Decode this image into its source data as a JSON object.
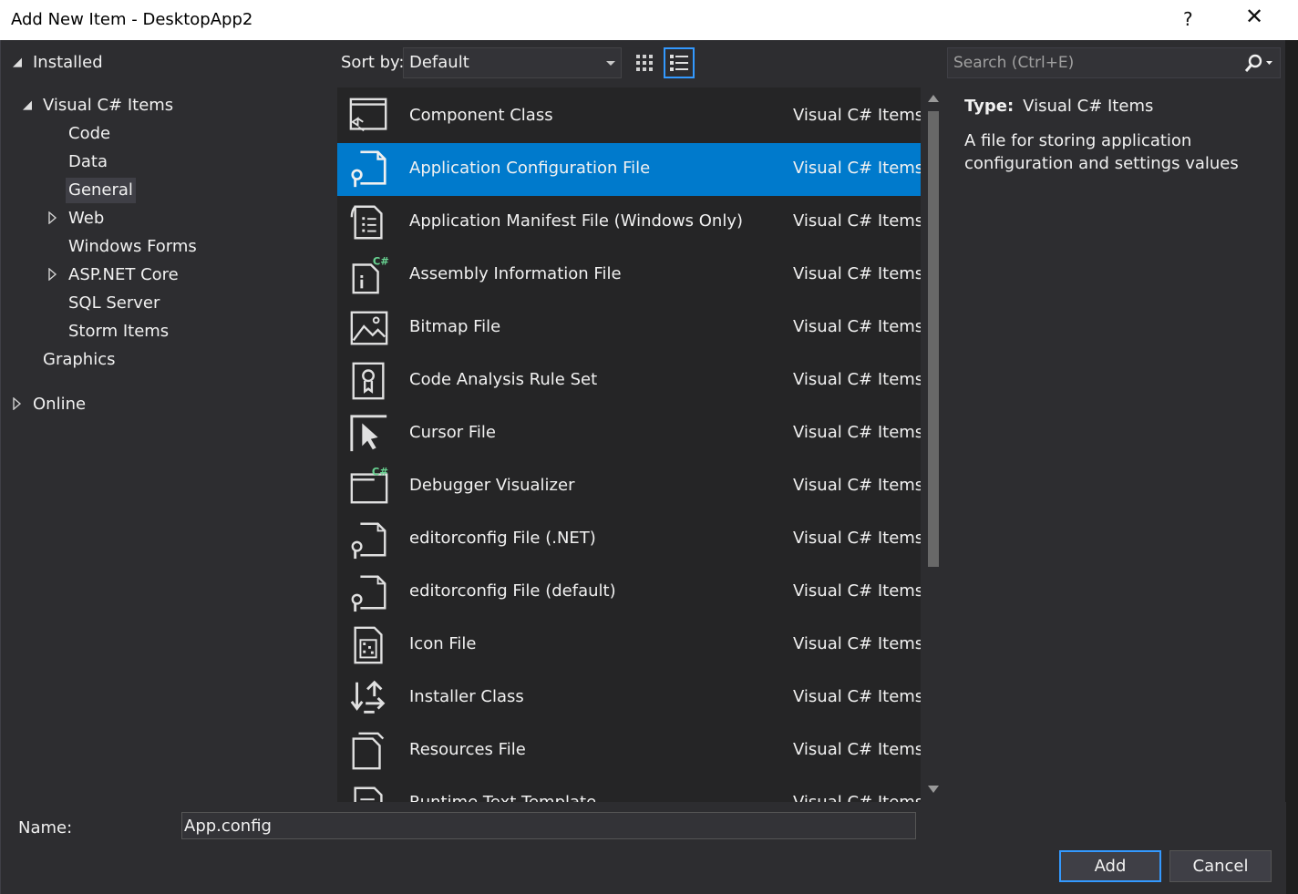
{
  "window": {
    "title": "Add New Item - DesktopApp2",
    "help_label": "?",
    "close_label": "✕"
  },
  "tree": {
    "installed": "Installed",
    "visual_csharp": "Visual C# Items",
    "children": [
      "Code",
      "Data",
      "General",
      "Web",
      "Windows Forms",
      "ASP.NET Core",
      "SQL Server",
      "Storm Items"
    ],
    "graphics": "Graphics",
    "online": "Online",
    "selected": "General"
  },
  "toolbar": {
    "sort_label": "Sort by:",
    "sort_value": "Default"
  },
  "search": {
    "placeholder": "Search (Ctrl+E)"
  },
  "items": [
    {
      "name": "Component Class",
      "category": "Visual C# Items",
      "icon": "component-class-icon"
    },
    {
      "name": "Application Configuration File",
      "category": "Visual C# Items",
      "icon": "config-file-icon"
    },
    {
      "name": "Application Manifest File (Windows Only)",
      "category": "Visual C# Items",
      "icon": "manifest-file-icon"
    },
    {
      "name": "Assembly Information File",
      "category": "Visual C# Items",
      "icon": "assembly-info-icon"
    },
    {
      "name": "Bitmap File",
      "category": "Visual C# Items",
      "icon": "bitmap-file-icon"
    },
    {
      "name": "Code Analysis Rule Set",
      "category": "Visual C# Items",
      "icon": "rule-set-icon"
    },
    {
      "name": "Cursor File",
      "category": "Visual C# Items",
      "icon": "cursor-file-icon"
    },
    {
      "name": "Debugger Visualizer",
      "category": "Visual C# Items",
      "icon": "debugger-visualizer-icon"
    },
    {
      "name": "editorconfig File (.NET)",
      "category": "Visual C# Items",
      "icon": "editorconfig-icon"
    },
    {
      "name": "editorconfig File (default)",
      "category": "Visual C# Items",
      "icon": "editorconfig-icon"
    },
    {
      "name": "Icon File",
      "category": "Visual C# Items",
      "icon": "icon-file-icon"
    },
    {
      "name": "Installer Class",
      "category": "Visual C# Items",
      "icon": "installer-class-icon"
    },
    {
      "name": "Resources File",
      "category": "Visual C# Items",
      "icon": "resources-file-icon"
    },
    {
      "name": "Runtime Text Template",
      "category": "Visual C# Items",
      "icon": "text-template-icon"
    }
  ],
  "selected_item": "Application Configuration File",
  "details": {
    "type_label": "Type:",
    "type_value": "Visual C# Items",
    "description": "A file for storing application configuration and settings values"
  },
  "footer": {
    "name_label": "Name:",
    "name_value": "App.config",
    "add_label": "Add",
    "cancel_label": "Cancel"
  },
  "colors": {
    "accent": "#007acc",
    "csharp_badge": "#68d391"
  }
}
